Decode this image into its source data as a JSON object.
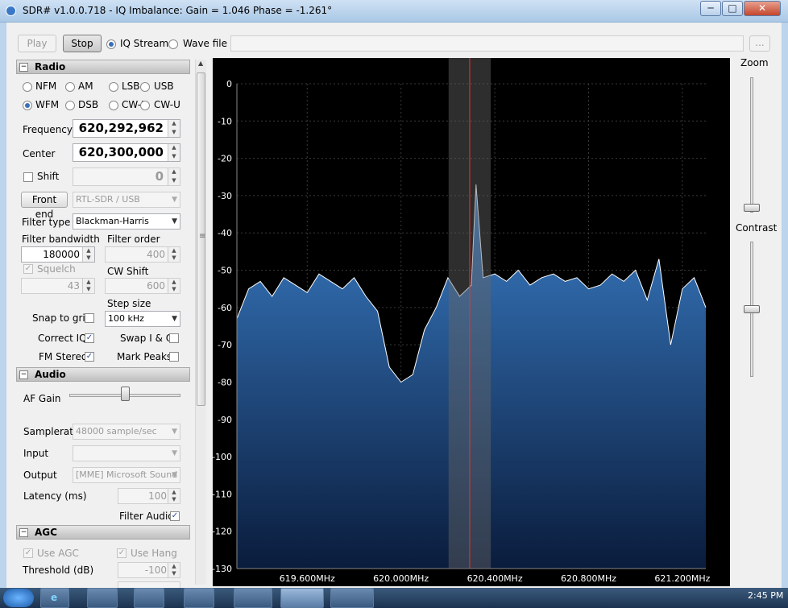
{
  "window": {
    "title": "SDR# v1.0.0.718 - IQ Imbalance: Gain = 1.046 Phase = -1.261°"
  },
  "toolbar": {
    "play": "Play",
    "stop": "Stop",
    "iq_stream": "IQ Stream",
    "wave_file": "Wave file",
    "browse": "..."
  },
  "radio": {
    "title": "Radio",
    "modes": [
      "NFM",
      "AM",
      "LSB",
      "USB",
      "WFM",
      "DSB",
      "CW-L",
      "CW-U"
    ],
    "selected_mode": "WFM",
    "frequency_label": "Frequency",
    "frequency": "620,292,962",
    "center_label": "Center",
    "center": "620,300,000",
    "shift_label": "Shift",
    "shift": "0",
    "front_end_button": "Front end",
    "front_end_value": "RTL-SDR / USB",
    "filter_type_label": "Filter type",
    "filter_type": "Blackman-Harris",
    "filter_bandwidth_label": "Filter bandwidth",
    "filter_bandwidth": "180000",
    "filter_order_label": "Filter order",
    "filter_order": "400",
    "squelch_label": "Squelch",
    "squelch": "43",
    "cw_shift_label": "CW Shift",
    "cw_shift": "600",
    "step_size_label": "Step size",
    "step_size": "100 kHz",
    "snap_to_grid": "Snap to grid",
    "swap_iq": "Swap I & Q",
    "correct_iq": "Correct IQ",
    "fm_stereo": "FM Stereo",
    "mark_peaks": "Mark Peaks"
  },
  "audio": {
    "title": "Audio",
    "af_gain_label": "AF Gain",
    "af_gain": 0.5,
    "samplerate_label": "Samplerate",
    "samplerate": "48000 sample/sec",
    "input_label": "Input",
    "input": "",
    "output_label": "Output",
    "output": "[MME] Microsoft Sound",
    "latency_label": "Latency (ms)",
    "latency": "100",
    "filter_audio": "Filter Audio"
  },
  "agc": {
    "title": "AGC",
    "use_agc": "Use AGC",
    "use_hang": "Use Hang",
    "threshold_label": "Threshold (dB)",
    "threshold": "-100"
  },
  "side": {
    "zoom": "Zoom",
    "contrast": "Contrast"
  },
  "colors": {
    "spectrum_fill_top": "#3a7ec8",
    "spectrum_fill_bottom": "#0a1c3c",
    "spectrum_line": "#ffffff",
    "center_line": "#ff2a2a",
    "bandwidth_overlay": "#666666"
  },
  "chart_data": {
    "type": "area",
    "ylim": [
      -130,
      0
    ],
    "y_ticks": [
      "0",
      "-10",
      "-20",
      "-30",
      "-40",
      "-50",
      "-60",
      "-70",
      "-80",
      "-90",
      "-100",
      "-110",
      "-120",
      "-130"
    ],
    "x_tick_labels": [
      "619.600MHz",
      "620.000MHz",
      "620.400MHz",
      "620.800MHz",
      "621.200MHz"
    ],
    "x_ticks": [
      619.6,
      620.0,
      620.4,
      620.8,
      621.2
    ],
    "xlim": [
      619.3,
      621.3
    ],
    "tuned_frequency": 620.292962,
    "bandwidth": 0.18,
    "x": [
      619.3,
      619.35,
      619.4,
      619.45,
      619.5,
      619.55,
      619.6,
      619.65,
      619.7,
      619.75,
      619.8,
      619.85,
      619.9,
      619.95,
      620.0,
      620.05,
      620.1,
      620.15,
      620.2,
      620.25,
      620.3,
      620.32,
      620.35,
      620.4,
      620.45,
      620.5,
      620.55,
      620.6,
      620.65,
      620.7,
      620.75,
      620.8,
      620.85,
      620.9,
      620.95,
      621.0,
      621.05,
      621.1,
      621.15,
      621.2,
      621.25,
      621.3
    ],
    "y": [
      -63,
      -55,
      -53,
      -57,
      -52,
      -54,
      -56,
      -51,
      -53,
      -55,
      -52,
      -57,
      -61,
      -76,
      -80,
      -78,
      -66,
      -60,
      -52,
      -57,
      -54,
      -27,
      -52,
      -51,
      -53,
      -50,
      -54,
      -52,
      -51,
      -53,
      -52,
      -55,
      -54,
      -51,
      -53,
      -50,
      -58,
      -47,
      -70,
      -55,
      -52,
      -60
    ]
  },
  "taskbar": {
    "time": "2:45 PM"
  }
}
